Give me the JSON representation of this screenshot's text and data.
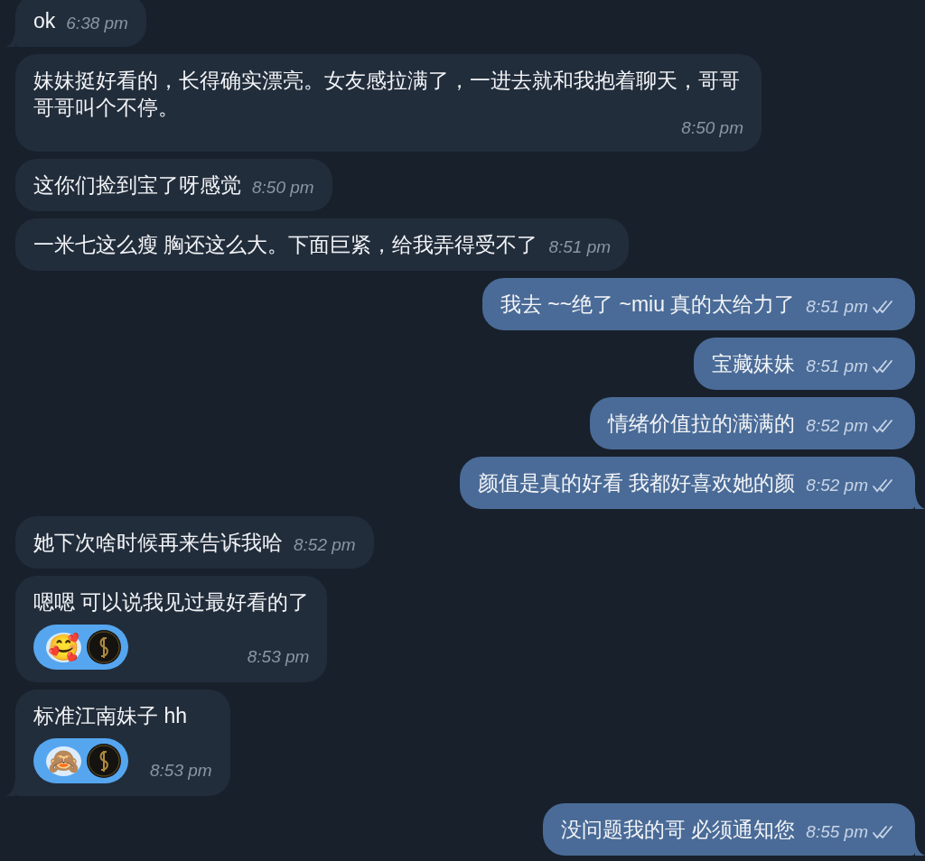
{
  "messages": [
    {
      "kind": "incoming",
      "text": "ok",
      "time": "6:38 pm",
      "tail": true
    },
    {
      "kind": "incoming",
      "text": "妹妹挺好看的，长得确实漂亮。女友感拉满了，一进去就和我抱着聊天，哥哥哥哥叫个不停。",
      "time": "8:50 pm",
      "tail": false
    },
    {
      "kind": "incoming",
      "text": "这你们捡到宝了呀感觉",
      "time": "8:50 pm",
      "tail": false
    },
    {
      "kind": "incoming",
      "text": "一米七这么瘦 胸还这么大。下面巨紧，给我弄得受不了",
      "time": "8:51 pm",
      "tail": false
    },
    {
      "kind": "outgoing",
      "text": "我去 ~~绝了 ~miu 真的太给力了",
      "time": "8:51 pm",
      "tail": false,
      "read": true
    },
    {
      "kind": "outgoing",
      "text": "宝藏妹妹",
      "time": "8:51 pm",
      "tail": false,
      "read": true
    },
    {
      "kind": "outgoing",
      "text": "情绪价值拉的满满的",
      "time": "8:52 pm",
      "tail": false,
      "read": true
    },
    {
      "kind": "outgoing",
      "text": "颜值是真的好看 我都好喜欢她的颜",
      "time": "8:52 pm",
      "tail": true,
      "read": true
    },
    {
      "kind": "incoming",
      "text": "她下次啥时候再来告诉我哈",
      "time": "8:52 pm",
      "tail": false
    },
    {
      "kind": "incoming",
      "text": "嗯嗯 可以说我见过最好看的了",
      "time": "8:53 pm",
      "tail": false,
      "reaction": {
        "emoji": "🥰"
      }
    },
    {
      "kind": "incoming",
      "text": "标准江南妹子 hh",
      "time": "8:53 pm",
      "tail": true,
      "reaction": {
        "emoji": "🙈"
      }
    },
    {
      "kind": "outgoing",
      "text": "没问题我的哥 必须通知您",
      "time": "8:55 pm",
      "tail": true,
      "read": true
    }
  ]
}
